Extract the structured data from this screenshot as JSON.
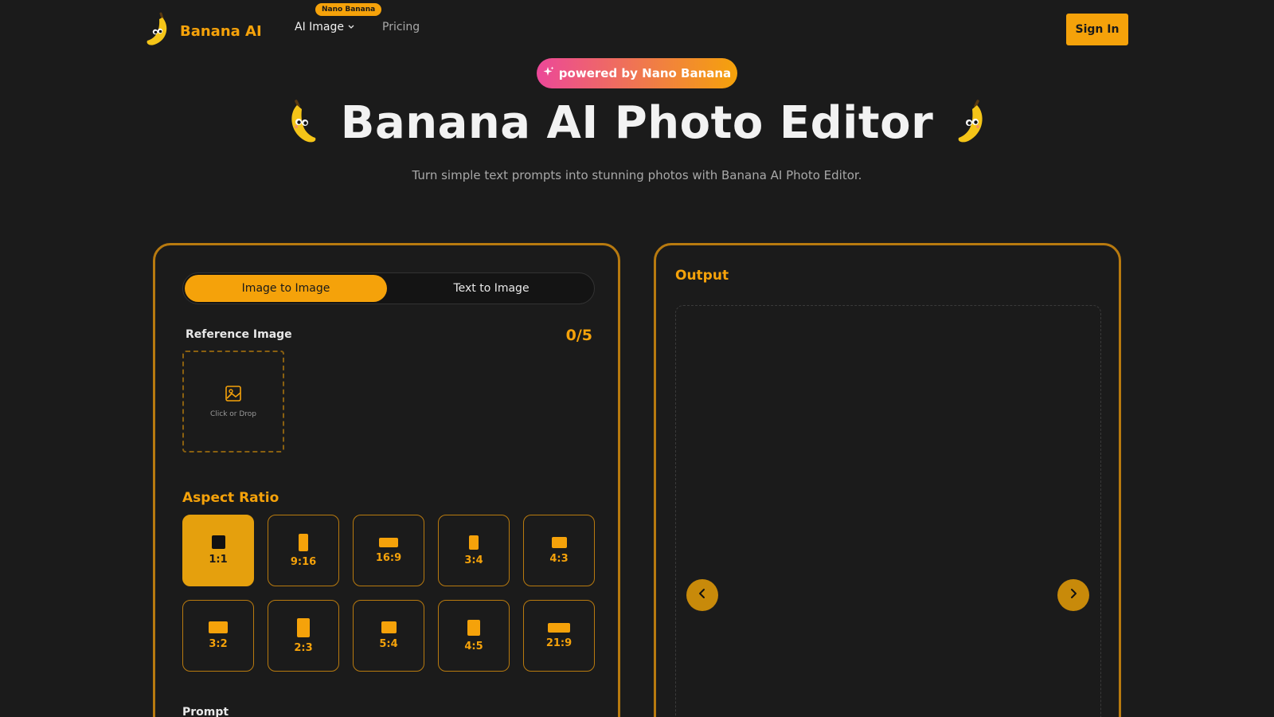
{
  "nav": {
    "logo_text": "Banana AI",
    "ai_image_label": "AI Image",
    "ai_image_badge": "Nano Banana",
    "pricing_label": "Pricing",
    "sign_in_label": "Sign In"
  },
  "hero": {
    "badge": "powered by Nano Banana",
    "title": "Banana AI Photo Editor",
    "subtitle": "Turn simple text prompts into stunning photos with Banana AI Photo Editor."
  },
  "editor": {
    "tabs": [
      {
        "label": "Image to Image",
        "active": true
      },
      {
        "label": "Text to Image",
        "active": false
      }
    ],
    "reference_label": "Reference Image",
    "reference_count": "0/5",
    "upload_text": "Click or Drop",
    "aspect_ratio_label": "Aspect Ratio",
    "aspect_ratios": [
      {
        "label": "1:1",
        "active": true
      },
      {
        "label": "9:16",
        "active": false
      },
      {
        "label": "16:9",
        "active": false
      },
      {
        "label": "3:4",
        "active": false
      },
      {
        "label": "4:3",
        "active": false
      },
      {
        "label": "3:2",
        "active": false
      },
      {
        "label": "2:3",
        "active": false
      },
      {
        "label": "5:4",
        "active": false
      },
      {
        "label": "4:5",
        "active": false
      },
      {
        "label": "21:9",
        "active": false
      }
    ],
    "prompt_label": "Prompt"
  },
  "output": {
    "label": "Output"
  },
  "colors": {
    "accent": "#f5a20a",
    "background": "#1b1b1b",
    "panel_border": "#b87a0f"
  }
}
